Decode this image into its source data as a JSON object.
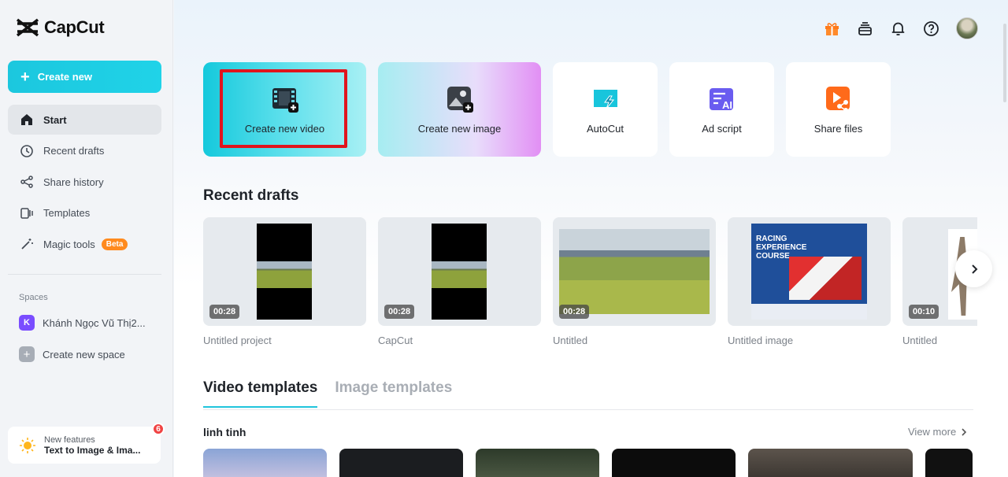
{
  "app": {
    "name": "CapCut"
  },
  "sidebar": {
    "create_label": "Create new",
    "items": [
      {
        "label": "Start",
        "icon": "home-icon",
        "active": true
      },
      {
        "label": "Recent drafts",
        "icon": "clock-icon"
      },
      {
        "label": "Share history",
        "icon": "share-icon"
      },
      {
        "label": "Templates",
        "icon": "templates-icon"
      },
      {
        "label": "Magic tools",
        "icon": "magic-wand-icon",
        "badge": "Beta"
      }
    ],
    "spaces_label": "Spaces",
    "spaces": [
      {
        "initial": "K",
        "label": "Khánh Ngọc Vũ Thị2..."
      },
      {
        "label": "Create new space"
      }
    ],
    "new_features": {
      "title": "New features",
      "subtitle": "Text to Image & Ima...",
      "count": "6"
    }
  },
  "quick_actions": [
    {
      "label": "Create new video",
      "icon": "film-plus-icon"
    },
    {
      "label": "Create new image",
      "icon": "image-plus-icon"
    },
    {
      "label": "AutoCut",
      "icon": "autocut-icon"
    },
    {
      "label": "Ad script",
      "icon": "ad-script-icon"
    },
    {
      "label": "Share files",
      "icon": "share-files-icon"
    }
  ],
  "recent_drafts": {
    "title": "Recent drafts",
    "items": [
      {
        "name": "Untitled project",
        "duration": "00:28"
      },
      {
        "name": "CapCut",
        "duration": "00:28"
      },
      {
        "name": "Untitled",
        "duration": "00:28"
      },
      {
        "name": "Untitled image",
        "thumb_title": "RACING EXPERIENCE COURSE"
      },
      {
        "name": "Untitled",
        "duration": "00:10"
      }
    ]
  },
  "templates": {
    "tabs": [
      "Video templates",
      "Image templates"
    ],
    "active_tab": 0,
    "group_title": "linh tinh",
    "view_more": "View more"
  },
  "colors": {
    "accent": "#20c4dc",
    "highlight": "#e0141d",
    "beta": "#ff8a1e"
  }
}
